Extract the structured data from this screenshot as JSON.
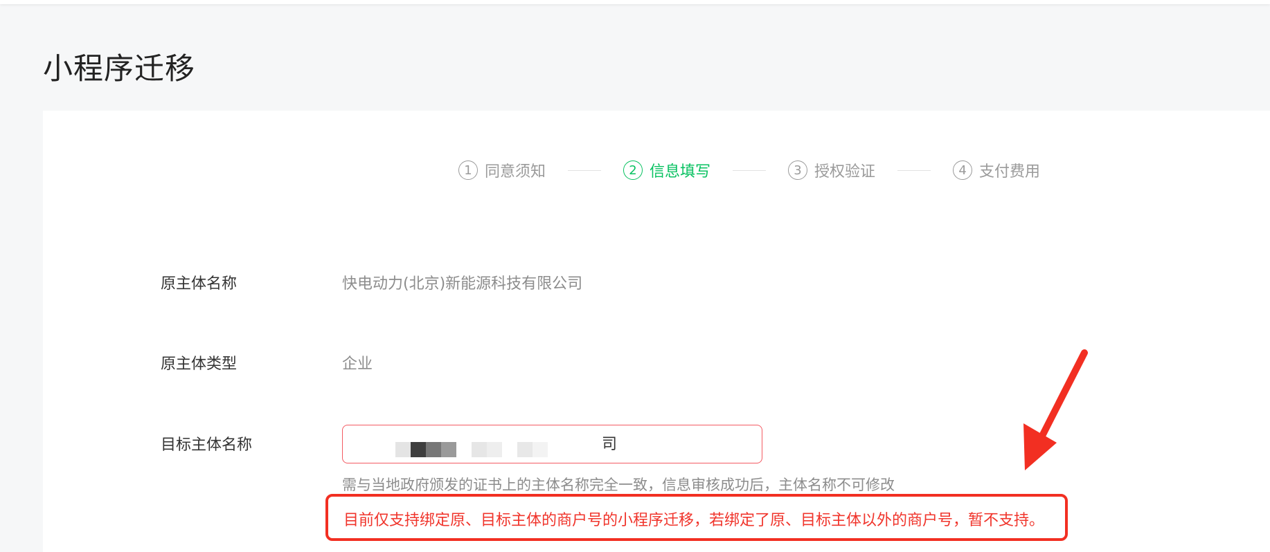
{
  "page": {
    "title": "小程序迁移"
  },
  "steps": [
    {
      "num": "1",
      "label": "同意须知",
      "active": false
    },
    {
      "num": "2",
      "label": "信息填写",
      "active": true
    },
    {
      "num": "3",
      "label": "授权验证",
      "active": false
    },
    {
      "num": "4",
      "label": "支付费用",
      "active": false
    }
  ],
  "form": {
    "original_name": {
      "label": "原主体名称",
      "value": "快电动力(北京)新能源科技有限公司"
    },
    "original_type": {
      "label": "原主体类型",
      "value": "企业"
    },
    "target_name": {
      "label": "目标主体名称",
      "value": "司",
      "hint": "需与当地政府颁发的证书上的主体名称完全一致，信息审核成功后，主体名称不可修改"
    }
  },
  "notice": {
    "text": "目前仅支持绑定原、目标主体的商户号的小程序迁移，若绑定了原、目标主体以外的商户号，暂不支持。"
  },
  "colors": {
    "accent": "#07c160",
    "error_border": "#f35a62",
    "warning": "#f22f22",
    "muted": "#8c8c8c"
  }
}
